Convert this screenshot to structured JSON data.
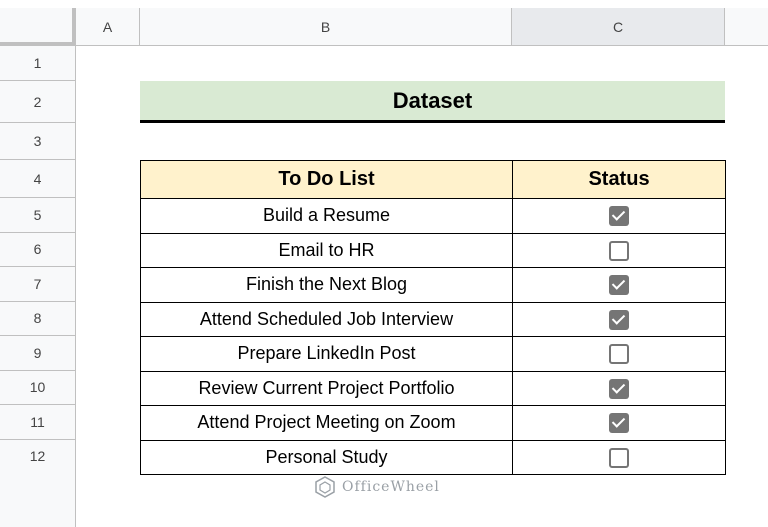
{
  "sheet": {
    "columns": [
      "A",
      "B",
      "C"
    ],
    "rows": [
      "1",
      "2",
      "3",
      "4",
      "5",
      "6",
      "7",
      "8",
      "9",
      "10",
      "11",
      "12"
    ]
  },
  "title": "Dataset",
  "table": {
    "headers": [
      "To Do List",
      "Status"
    ],
    "rows": [
      {
        "task": "Build a Resume",
        "checked": true
      },
      {
        "task": "Email to HR",
        "checked": false
      },
      {
        "task": "Finish the Next Blog",
        "checked": true
      },
      {
        "task": "Attend Scheduled Job Interview",
        "checked": true
      },
      {
        "task": "Prepare LinkedIn Post",
        "checked": false
      },
      {
        "task": "Review Current Project Portfolio",
        "checked": true
      },
      {
        "task": "Attend Project Meeting on Zoom",
        "checked": true
      },
      {
        "task": "Personal Study",
        "checked": false
      }
    ]
  },
  "watermark": "OfficeWheel",
  "colors": {
    "title_bg": "#d9ead3",
    "header_bg": "#fff2cc",
    "checkbox": "#757575"
  }
}
